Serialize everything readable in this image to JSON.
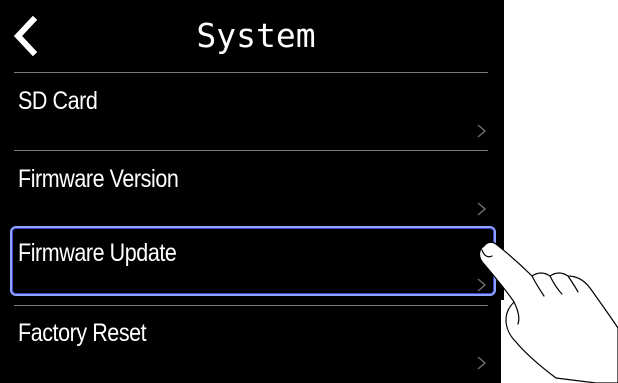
{
  "header": {
    "title": "System",
    "back_icon": "chevron-left-icon"
  },
  "menu": {
    "items": [
      {
        "label": "SD Card",
        "arrow": ">"
      },
      {
        "label": "Firmware Version",
        "arrow": ">"
      },
      {
        "label": "Firmware Update",
        "arrow": ">",
        "selected": true
      },
      {
        "label": "Factory Reset",
        "arrow": ">"
      }
    ]
  },
  "colors": {
    "background": "#000000",
    "text": "#ffffff",
    "divider": "#7a7a7a",
    "highlight": "#8fa2ff"
  },
  "overlay": {
    "icon": "finger-tap-hand-icon"
  }
}
